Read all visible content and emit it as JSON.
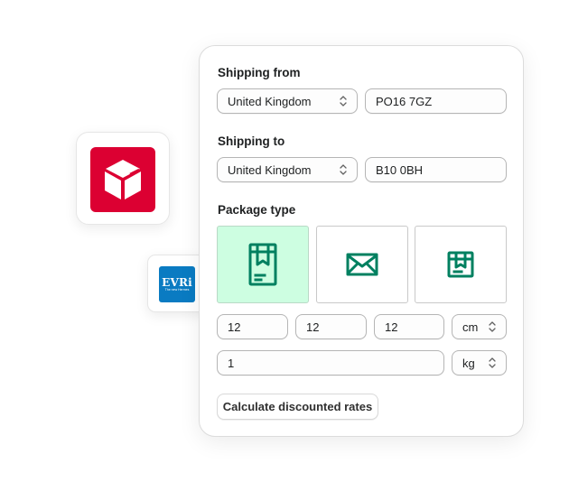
{
  "carriers": [
    {
      "name": "DPD",
      "icon": "dpd-cube-icon",
      "color": "#dc0032"
    },
    {
      "name": "EVRi",
      "tagline": "The new Hermes",
      "color": "#0a7bc2"
    }
  ],
  "form": {
    "shipping_from": {
      "label": "Shipping from",
      "country": "United Kingdom",
      "postcode": "PO16 7GZ"
    },
    "shipping_to": {
      "label": "Shipping to",
      "country": "United Kingdom",
      "postcode": "B10 0BH"
    },
    "package_type": {
      "label": "Package type",
      "options": [
        {
          "name": "box",
          "icon": "tall-box-icon",
          "selected": true
        },
        {
          "name": "envelope",
          "icon": "envelope-icon",
          "selected": false
        },
        {
          "name": "parcel",
          "icon": "parcel-box-icon",
          "selected": false
        }
      ],
      "accent_color": "#008060",
      "selected_bg": "#cdfee1"
    },
    "dimensions": {
      "length": "12",
      "width": "12",
      "height": "12",
      "unit": "cm"
    },
    "weight": {
      "value": "1",
      "unit": "kg"
    },
    "submit_label": "Calculate discounted rates"
  }
}
